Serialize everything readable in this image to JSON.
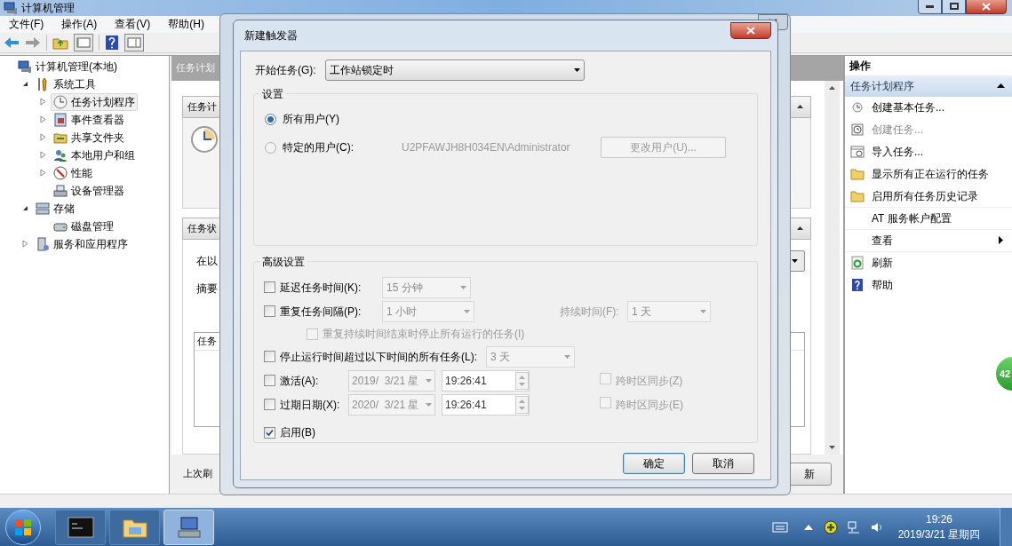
{
  "main_window": {
    "title": "计算机管理",
    "menu": [
      "文件(F)",
      "操作(A)",
      "查看(V)",
      "帮助(H)"
    ]
  },
  "tree": [
    {
      "label": "计算机管理(本地)",
      "kind": "computer",
      "selected": false,
      "children": [
        {
          "label": "系统工具",
          "kind": "tools",
          "selected": false,
          "expanded": true,
          "children": [
            {
              "label": "任务计划程序",
              "kind": "clock",
              "selected": true,
              "expanded": false
            },
            {
              "label": "事件查看器",
              "kind": "log",
              "selected": false,
              "expanded": false
            },
            {
              "label": "共享文件夹",
              "kind": "share",
              "selected": false,
              "expanded": false
            },
            {
              "label": "本地用户和组",
              "kind": "users",
              "selected": false,
              "expanded": false
            },
            {
              "label": "性能",
              "kind": "gauge",
              "selected": false,
              "expanded": false
            },
            {
              "label": "设备管理器",
              "kind": "device",
              "selected": false
            }
          ]
        },
        {
          "label": "存储",
          "kind": "storage",
          "selected": false,
          "expanded": true,
          "children": [
            {
              "label": "磁盘管理",
              "kind": "disk",
              "selected": false
            }
          ]
        },
        {
          "label": "服务和应用程序",
          "kind": "server",
          "selected": false,
          "expanded": false
        }
      ]
    }
  ],
  "middle": {
    "title": "任务计划",
    "overview_header": "任务计",
    "status_header": "任务状",
    "filter_label": "在以",
    "summary_label": "摘要",
    "list_column": "任务",
    "footer_label": "上次刷",
    "refresh_button": "新"
  },
  "trigger_dialog": {
    "title": "新建触发器",
    "begin": {
      "label": "开始任务(G):",
      "value": "工作站锁定时"
    },
    "settings": {
      "title": "设置",
      "options": [
        {
          "label": "所有用户(Y)",
          "selected": true
        },
        {
          "label": "特定的用户(C):",
          "selected": false
        }
      ],
      "user_name": "U2PFAWJH8H034EN\\Administrator",
      "change_user": "更改用户(U)...",
      "change_user_disabled": true
    },
    "advanced": {
      "title": "高级设置",
      "rows": [
        {
          "kind": "combo",
          "label": "延迟任务时间(K):",
          "checked": false,
          "value": "15 分钟",
          "disabled": true
        },
        {
          "kind": "repeat",
          "label": "重复任务间隔(P):",
          "checked": false,
          "value": "1 小时",
          "disabled": true,
          "extra_label": "持续时间(F):",
          "extra_value": "1 天"
        },
        {
          "kind": "sub",
          "label": "重复持续时间结束时停止所有运行的任务(I)",
          "checked": false,
          "disabled": true
        },
        {
          "kind": "combo",
          "label": "停止运行时间超过以下时间的所有任务(L):",
          "checked": false,
          "value": "3 天",
          "disabled": true
        },
        {
          "kind": "date",
          "label": "激活(A):",
          "checked": false,
          "date": "2019/  3/21 星",
          "time": "19:26:41",
          "disabled": true,
          "sync_label": "跨时区同步(Z)",
          "sync_checked": false
        },
        {
          "kind": "date",
          "label": "过期日期(X):",
          "checked": false,
          "date": "2020/  3/21 星",
          "time": "19:26:41",
          "disabled": true,
          "sync_label": "跨时区同步(E)",
          "sync_checked": false
        },
        {
          "kind": "check",
          "label": "启用(B)",
          "checked": true
        }
      ]
    },
    "buttons": [
      {
        "label": "确定",
        "default": true
      },
      {
        "label": "取消",
        "default": false
      }
    ]
  },
  "actions": {
    "title": "操作",
    "group": "任务计划程序",
    "expanded": true,
    "items": [
      {
        "label": "创建基本任务...",
        "kind": "clock",
        "disabled": false
      },
      {
        "label": "创建任务...",
        "kind": "task",
        "disabled": true
      },
      {
        "label": "导入任务...",
        "kind": "import",
        "disabled": false
      },
      {
        "label": "显示所有正在运行的任务",
        "kind": "folder",
        "disabled": false
      },
      {
        "label": "启用所有任务历史记录",
        "kind": "folder",
        "disabled": false
      },
      {
        "label": "AT 服务帐户配置",
        "kind": "none",
        "disabled": false
      },
      {
        "label": "查看",
        "kind": "submenu",
        "disabled": false
      },
      {
        "label": "刷新",
        "kind": "refresh",
        "disabled": false
      },
      {
        "label": "帮助",
        "kind": "help",
        "disabled": false
      }
    ]
  },
  "notification_badge": "42",
  "taskbar": {
    "time": "19:26",
    "date": "2019/3/21 星期四",
    "apps": [
      {
        "kind": "console",
        "selected": false
      },
      {
        "kind": "explorer",
        "selected": false
      },
      {
        "kind": "management",
        "selected": true
      }
    ]
  }
}
